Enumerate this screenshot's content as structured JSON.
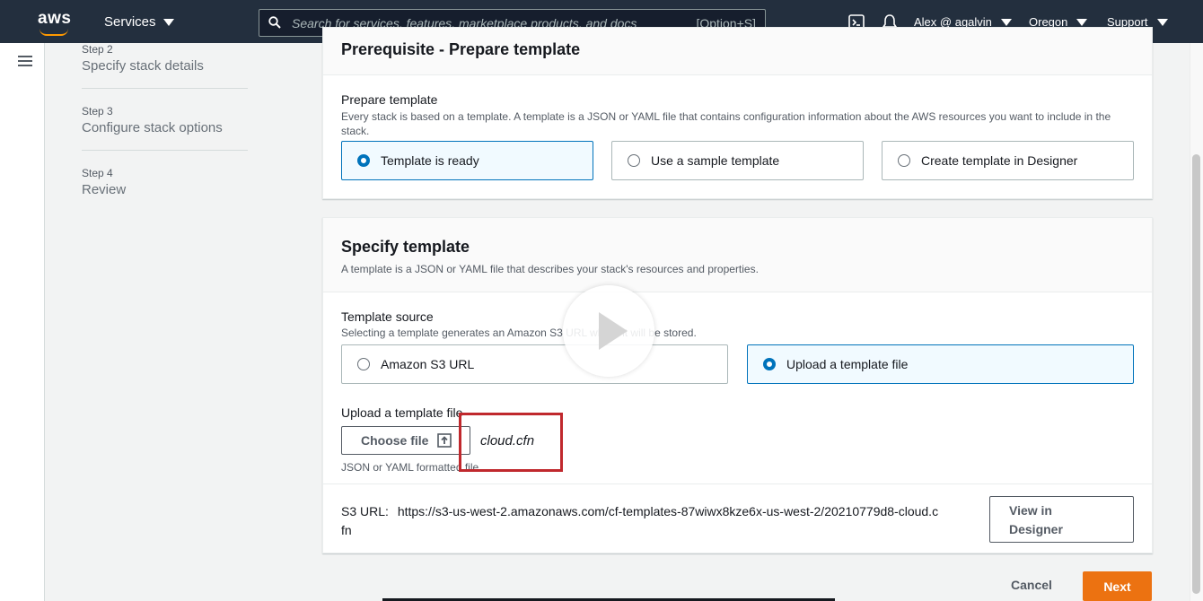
{
  "topnav": {
    "logo_text": "aws",
    "services_label": "Services",
    "search_placeholder": "Search for services, features, marketplace products, and docs",
    "search_shortcut": "[Option+S]",
    "user_label": "Alex @ agalvin",
    "region_label": "Oregon",
    "support_label": "Support"
  },
  "steps": [
    {
      "num": "Step 2",
      "name": "Specify stack details"
    },
    {
      "num": "Step 3",
      "name": "Configure stack options"
    },
    {
      "num": "Step 4",
      "name": "Review"
    }
  ],
  "prerequisite": {
    "title": "Prerequisite - Prepare template",
    "field_label": "Prepare template",
    "field_desc": "Every stack is based on a template. A template is a JSON or YAML file that contains configuration information about the AWS resources you want to include in the stack.",
    "options": [
      "Template is ready",
      "Use a sample template",
      "Create template in Designer"
    ],
    "selected_index": 0
  },
  "specify": {
    "title": "Specify template",
    "desc": "A template is a JSON or YAML file that describes your stack's resources and properties.",
    "source_label": "Template source",
    "source_desc": "Selecting a template generates an Amazon S3 URL where it will be stored.",
    "source_options": [
      "Amazon S3 URL",
      "Upload a template file"
    ],
    "source_selected_index": 1,
    "upload_label": "Upload a template file",
    "choose_file_label": "Choose file",
    "file_name": "cloud.cfn",
    "upload_hint": "JSON or YAML formatted file",
    "s3_url_label": "S3 URL:",
    "s3_url_value_line1": "https://s3-us-west-2.amazonaws.com/cf-templates-87wiwx8kze6x-us-west-2/20210779d8-cloud.c",
    "s3_url_value_line2": "fn",
    "view_designer_line1": "View in",
    "view_designer_line2": "Designer"
  },
  "footer": {
    "cancel_label": "Cancel",
    "next_label": "Next"
  },
  "colors": {
    "nav_bg": "#232f3e",
    "accent_blue": "#0073bb",
    "primary_orange": "#ec7211",
    "highlight_red": "#c0282d"
  }
}
